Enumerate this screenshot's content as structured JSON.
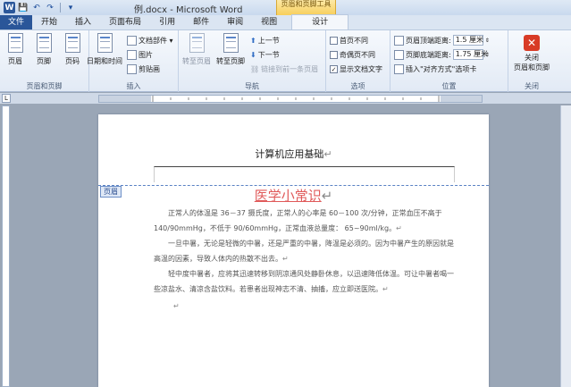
{
  "window": {
    "title": "例.docx - Microsoft Word",
    "context_group": "页眉和页脚工具"
  },
  "qat": {
    "word_logo": "W",
    "save_icon": "save-icon",
    "undo_icon": "undo-icon",
    "redo_icon": "redo-icon",
    "customize_icon": "dropdown-icon"
  },
  "tabs": [
    {
      "label": "文件",
      "id": "file"
    },
    {
      "label": "开始",
      "id": "home"
    },
    {
      "label": "插入",
      "id": "insert"
    },
    {
      "label": "页面布局",
      "id": "layout"
    },
    {
      "label": "引用",
      "id": "references"
    },
    {
      "label": "邮件",
      "id": "mailings"
    },
    {
      "label": "审阅",
      "id": "review"
    },
    {
      "label": "视图",
      "id": "view"
    },
    {
      "label": "设计",
      "id": "design"
    }
  ],
  "ribbon": {
    "hf_group": {
      "label": "页眉和页脚",
      "header_btn": "页眉",
      "footer_btn": "页脚",
      "pagenum_btn": "页码"
    },
    "insert_group": {
      "label": "插入",
      "datetime_btn": "日期和时间",
      "docparts_btn": "文档部件 ▾",
      "picture_btn": "图片",
      "clipart_btn": "剪贴画"
    },
    "nav_group": {
      "label": "导航",
      "goto_header_btn": "转至页眉",
      "goto_footer_btn": "转至页脚",
      "prev_btn": "上一节",
      "next_btn": "下一节",
      "link_prev_btn": "链接到前一条页眉"
    },
    "options_group": {
      "label": "选项",
      "diff_first": "首页不同",
      "diff_odd_even": "奇偶页不同",
      "show_doc_text": "显示文档文字",
      "show_doc_text_checked": "✓"
    },
    "position_group": {
      "label": "位置",
      "header_top_label": "页眉顶端距离:",
      "header_top_value": "1.5 厘米",
      "footer_bottom_label": "页脚底端距离:",
      "footer_bottom_value": "1.75 厘米",
      "insert_align_tab": "插入\"对齐方式\"选项卡"
    },
    "close_group": {
      "label": "关闭",
      "close_btn_line1": "关闭",
      "close_btn_line2": "页眉和页脚"
    }
  },
  "ruler": {
    "corner": "L"
  },
  "document": {
    "header_text": "计算机应用基础",
    "header_tag": "页眉",
    "title": "医学小常识",
    "paragraphs": [
      "正常人的体温是 36－37 摄氏度，正常人的心率是 60－100 次/分钟，正常血压不高于 140/90mmHg，不低于 90/60mmHg，正常血液总量度： 65~90ml/kg。",
      "一旦中暑，无论是轻微的中暑，还是严重的中暑，降温是必须的。因为中暑产生的原因就是高温的因素，导致人体内的热散不出去。",
      "轻中度中暑者，应将其迅速转移到阴凉通风处静卧休息，以迅速降低体温。可让中暑者喝一些凉盐水、清凉含盐饮料。若患者出现神志不清、抽搐，应立即送医院。"
    ],
    "para_mark": "↵"
  }
}
